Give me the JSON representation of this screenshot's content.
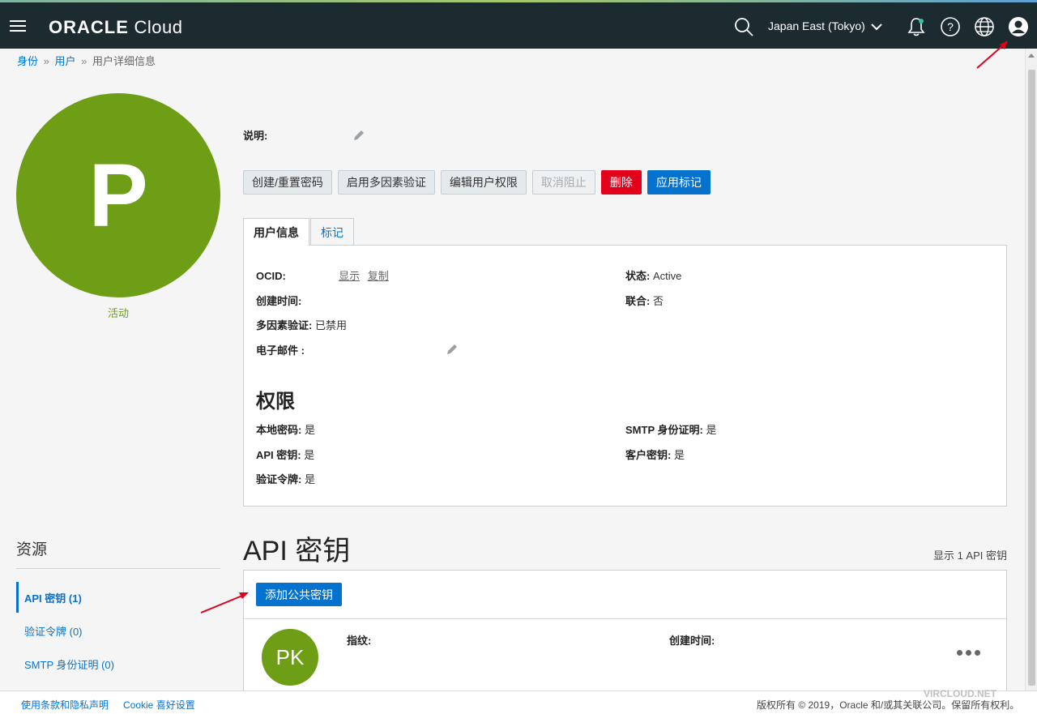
{
  "header": {
    "logo_brand": "ORACLE",
    "logo_product": "Cloud",
    "region": "Japan East (Tokyo)"
  },
  "breadcrumb": {
    "items": [
      "身份",
      "用户",
      "用户详细信息"
    ],
    "separator": "»"
  },
  "user": {
    "avatar_letter": "P",
    "status": "活动"
  },
  "description": {
    "label": "说明:"
  },
  "actions": {
    "create_reset_password": "创建/重置密码",
    "enable_mfa": "启用多因素验证",
    "edit_capabilities": "编辑用户权限",
    "unblock": "取消阻止",
    "delete": "删除",
    "apply_tags": "应用标记"
  },
  "tabs": {
    "user_info": "用户信息",
    "tags": "标记"
  },
  "user_info": {
    "ocid_label": "OCID:",
    "ocid_show": "显示",
    "ocid_copy": "复制",
    "created_label": "创建时间:",
    "mfa_label": "多因素验证:",
    "mfa_value": "已禁用",
    "email_label": "电子邮件 :",
    "status_label": "状态:",
    "status_value": "Active",
    "federated_label": "联合:",
    "federated_value": "否"
  },
  "capabilities": {
    "title": "权限",
    "local_password_label": "本地密码:",
    "local_password_value": "是",
    "api_keys_label": "API 密钥:",
    "api_keys_value": "是",
    "auth_tokens_label": "验证令牌:",
    "auth_tokens_value": "是",
    "smtp_label": "SMTP 身份证明:",
    "smtp_value": "是",
    "customer_secret_label": "客户密钥:",
    "customer_secret_value": "是"
  },
  "resources": {
    "title": "资源",
    "items": [
      "API 密钥 (1)",
      "验证令牌 (0)",
      "SMTP 身份证明 (0)"
    ]
  },
  "api_keys": {
    "title": "API 密钥",
    "count_text": "显示 1 API 密钥",
    "add_button": "添加公共密钥",
    "row": {
      "avatar": "PK",
      "fingerprint_label": "指纹:",
      "created_label": "创建时间:"
    }
  },
  "footer": {
    "terms": "使用条款和隐私声明",
    "cookie": "Cookie 喜好设置",
    "copyright": "版权所有 © 2019，Oracle 和/或其关联公司。保留所有权利。",
    "watermark": "VIRCLOUD.NET"
  },
  "colors": {
    "topbar": "#1c2b2f",
    "accent_blue": "#0572ce",
    "avatar_green": "#6e9d16",
    "danger_red": "#e3001b"
  },
  "icons": [
    "hamburger-icon",
    "search-icon",
    "chevron-down-icon",
    "bell-icon",
    "help-icon",
    "globe-icon",
    "profile-icon",
    "pencil-icon",
    "more-icon"
  ]
}
